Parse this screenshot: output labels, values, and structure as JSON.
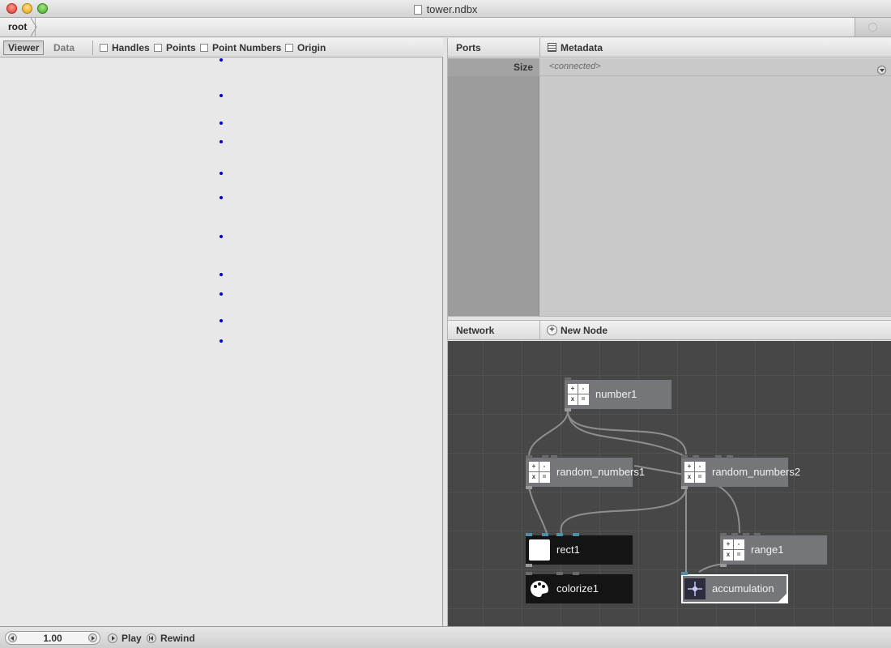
{
  "window": {
    "title": "tower.ndbx"
  },
  "breadcrumb": {
    "root": "root"
  },
  "viewer": {
    "tabs": {
      "viewer": "Viewer",
      "data": "Data"
    },
    "options": {
      "handles": "Handles",
      "points": "Points",
      "point_numbers": "Point Numbers",
      "origin": "Origin"
    }
  },
  "ports": {
    "header": "Ports",
    "metadata": "Metadata",
    "rows": [
      {
        "label": "Size",
        "value": "<connected>"
      }
    ]
  },
  "network": {
    "header": "Network",
    "new_node": "New Node",
    "nodes": {
      "number1": "number1",
      "random_numbers1": "random_numbers1",
      "random_numbers2": "random_numbers2",
      "rect1": "rect1",
      "range1": "range1",
      "colorize1": "colorize1",
      "accumulation": "accumulation"
    },
    "math_glyphs": [
      "+",
      "-",
      "x",
      "="
    ]
  },
  "playback": {
    "frame": "1.00",
    "play": "Play",
    "rewind": "Rewind"
  },
  "colors": {
    "point": "#0000dd",
    "network_bg": "#474747",
    "node_gray": "#757679",
    "node_black": "#141414"
  }
}
